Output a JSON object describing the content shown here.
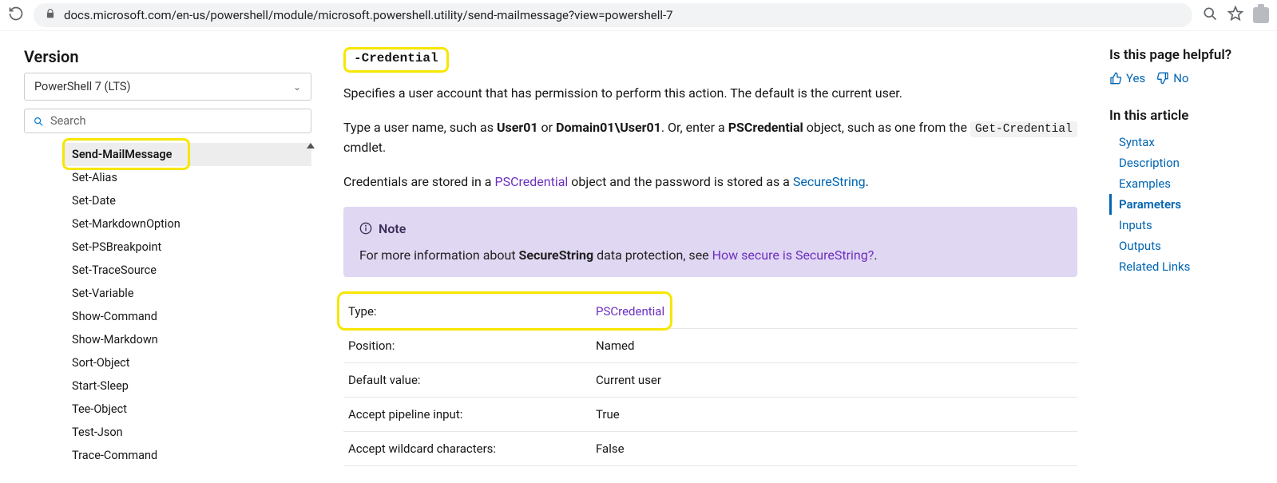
{
  "browser": {
    "url": "docs.microsoft.com/en-us/powershell/module/microsoft.powershell.utility/send-mailmessage?view=powershell-7"
  },
  "left": {
    "version_label": "Version",
    "version_value": "PowerShell 7 (LTS)",
    "search_placeholder": "Search",
    "nav": [
      "Send-MailMessage",
      "Set-Alias",
      "Set-Date",
      "Set-MarkdownOption",
      "Set-PSBreakpoint",
      "Set-TraceSource",
      "Set-Variable",
      "Show-Command",
      "Show-Markdown",
      "Sort-Object",
      "Start-Sleep",
      "Tee-Object",
      "Test-Json",
      "Trace-Command"
    ]
  },
  "main": {
    "param_name": "-Credential",
    "p1": "Specifies a user account that has permission to perform this action. The default is the current user.",
    "p2a": "Type a user name, such as ",
    "p2_user": "User01",
    "p2b": " or ",
    "p2_domuser": "Domain01\\User01",
    "p2c": ". Or, enter a ",
    "p2_pscred": "PSCredential",
    "p2d": " object, such as one from the ",
    "p2_code": "Get-Credential",
    "p2e": " cmdlet.",
    "p3a": "Credentials are stored in a ",
    "p3_link1": "PSCredential",
    "p3b": " object and the password is stored as a ",
    "p3_link2": "SecureString",
    "p3c": ".",
    "note_title": "Note",
    "note_a": "For more information about ",
    "note_bold": "SecureString",
    "note_b": " data protection, see ",
    "note_link": "How secure is SecureString?",
    "note_c": ".",
    "table": {
      "type_k": "Type:",
      "type_v": "PSCredential",
      "pos_k": "Position:",
      "pos_v": "Named",
      "def_k": "Default value:",
      "def_v": "Current user",
      "pipe_k": "Accept pipeline input:",
      "pipe_v": "True",
      "wild_k": "Accept wildcard characters:",
      "wild_v": "False"
    }
  },
  "right": {
    "helpful": "Is this page helpful?",
    "yes": "Yes",
    "no": "No",
    "in_this_article": "In this article",
    "toc": [
      "Syntax",
      "Description",
      "Examples",
      "Parameters",
      "Inputs",
      "Outputs",
      "Related Links"
    ],
    "toc_active": "Parameters"
  }
}
